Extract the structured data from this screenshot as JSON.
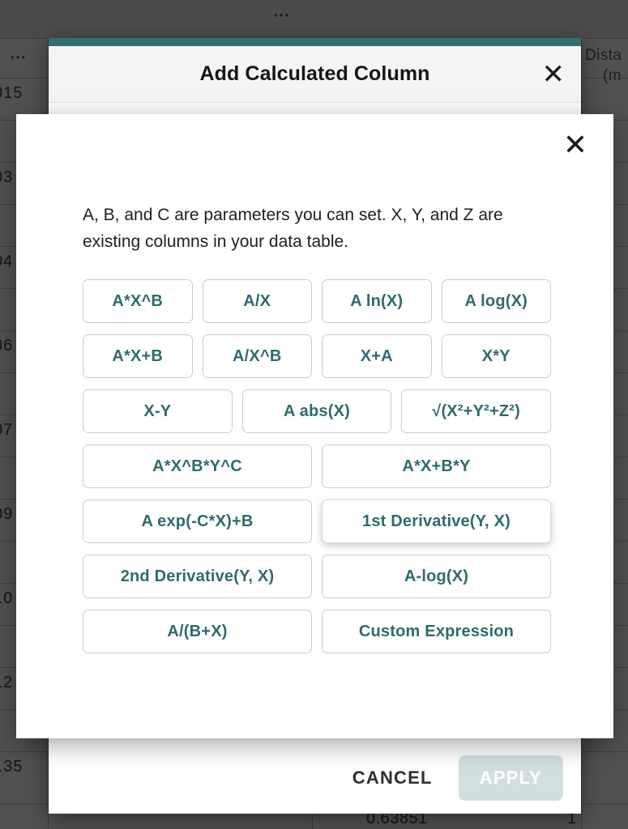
{
  "background": {
    "menu_icon": "overflow-menu-icon",
    "column_header_right_line1": "Dista",
    "column_header_right_line2": "(m",
    "left_cells": [
      "015",
      "03",
      "04",
      "06",
      "07",
      "09",
      "10",
      "12",
      "135"
    ],
    "bottom_row": {
      "value_1": "0.63851",
      "value_2": "1"
    }
  },
  "outer_dialog": {
    "title": "Add Calculated Column",
    "close_icon": "close-icon",
    "footer": {
      "cancel_label": "CANCEL",
      "apply_label": "APPLY"
    },
    "accent_color": "#32706f"
  },
  "inner_dialog": {
    "close_icon": "close-icon",
    "description": "A, B, and C are parameters you can set. X, Y, and Z are existing columns in your data table.",
    "accent_text_color": "#2e6b6e",
    "formulas": [
      {
        "label": "A*X^B",
        "span": 4,
        "hovered": false
      },
      {
        "label": "A/X",
        "span": 4,
        "hovered": false
      },
      {
        "label": "A ln(X)",
        "span": 4,
        "hovered": false
      },
      {
        "label": "A log(X)",
        "span": 4,
        "hovered": false
      },
      {
        "label": "A*X+B",
        "span": 4,
        "hovered": false
      },
      {
        "label": "A/X^B",
        "span": 4,
        "hovered": false
      },
      {
        "label": "X+A",
        "span": 4,
        "hovered": false
      },
      {
        "label": "X*Y",
        "span": 4,
        "hovered": false
      },
      {
        "label": "X-Y",
        "span": 3,
        "hovered": false
      },
      {
        "label": "A abs(X)",
        "span": 3,
        "hovered": false
      },
      {
        "label": "√(X²+Y²+Z²)",
        "span": 3,
        "hovered": false
      },
      {
        "label": "A*X^B*Y^C",
        "span": 2,
        "hovered": false
      },
      {
        "label": "A*X+B*Y",
        "span": 2,
        "hovered": false
      },
      {
        "label": "A exp(-C*X)+B",
        "span": 2,
        "hovered": false
      },
      {
        "label": "1st Derivative(Y, X)",
        "span": 2,
        "hovered": true
      },
      {
        "label": "2nd Derivative(Y, X)",
        "span": 2,
        "hovered": false
      },
      {
        "label": "A-log(X)",
        "span": 2,
        "hovered": false
      },
      {
        "label": "A/(B+X)",
        "span": 2,
        "hovered": false
      },
      {
        "label": "Custom Expression",
        "span": 2,
        "hovered": false
      }
    ]
  }
}
